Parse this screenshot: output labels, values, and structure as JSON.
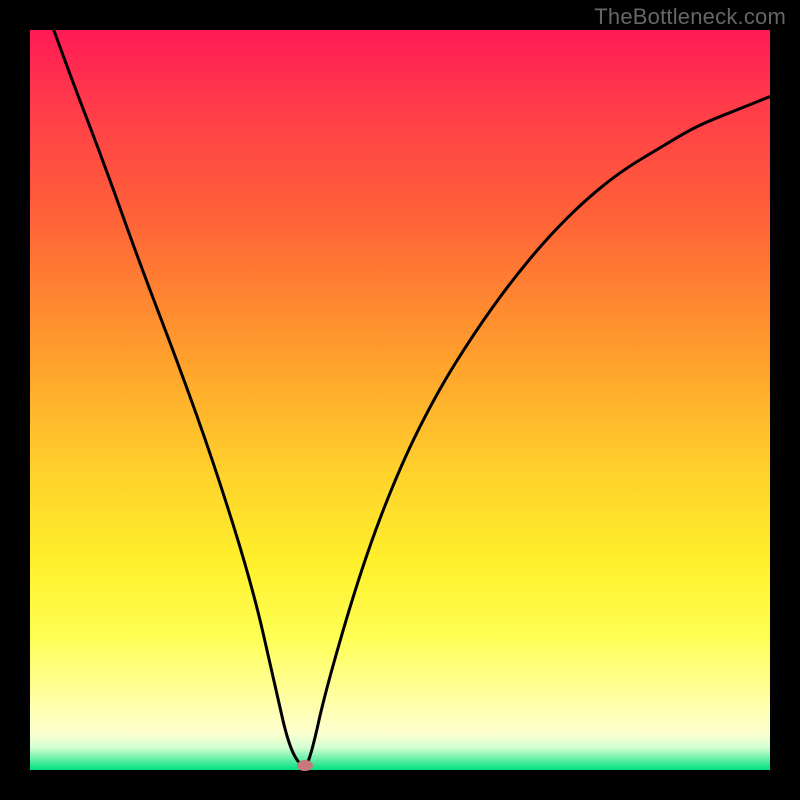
{
  "watermark": "TheBottleneck.com",
  "chart_data": {
    "type": "line",
    "title": "",
    "xlabel": "",
    "ylabel": "",
    "xlim": [
      0,
      100
    ],
    "ylim": [
      0,
      100
    ],
    "background": "gradient-green-yellow-red",
    "series": [
      {
        "name": "bottleneck-curve",
        "x": [
          0,
          5,
          10,
          15,
          20,
          25,
          30,
          33,
          35,
          37,
          38,
          40,
          45,
          50,
          55,
          60,
          65,
          70,
          75,
          80,
          85,
          90,
          95,
          100
        ],
        "y": [
          109,
          95,
          82,
          68,
          55,
          41,
          25,
          12,
          3,
          0,
          2,
          11,
          28,
          41,
          51,
          59,
          66,
          72,
          77,
          81,
          84,
          87,
          89,
          91
        ]
      }
    ],
    "marker": {
      "x": 37.2,
      "y": 0.5,
      "color": "#c67a7a"
    },
    "notes": "V-shaped curve with minimum near x≈37 at y≈0; left arm goes off top; right arm rises toward ~91; green band at bottom indicates optimal zone."
  },
  "colors": {
    "curve": "#000000",
    "marker": "#c67a7a",
    "frame": "#000000"
  }
}
